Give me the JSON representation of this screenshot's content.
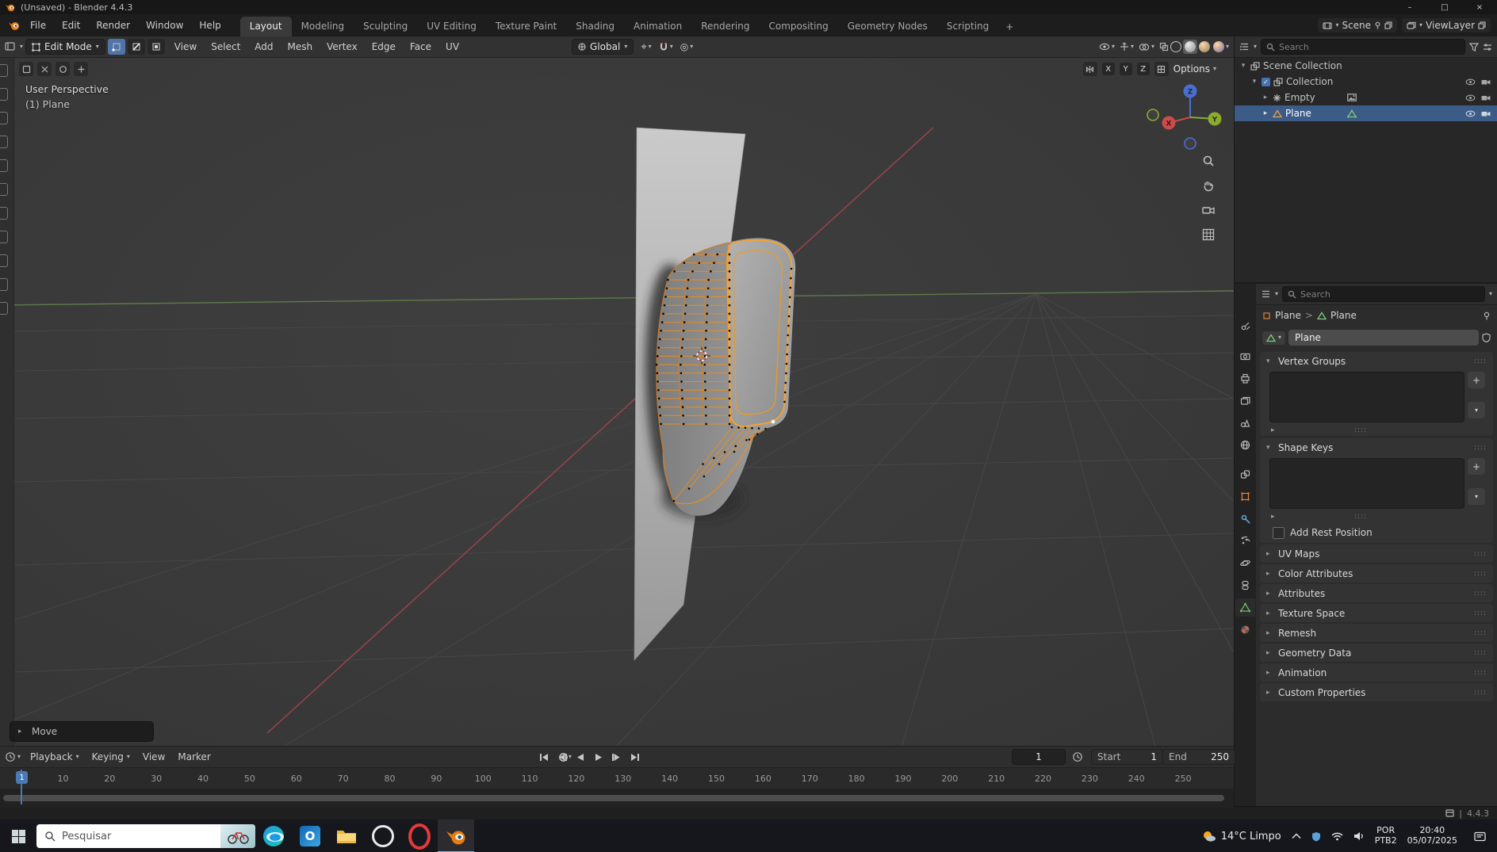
{
  "colors": {
    "accent_orange": "#ff9e2b",
    "selection_blue": "#4772b3",
    "outliner_selection": "#3c5b87",
    "axis_x": "#a4454f",
    "axis_y": "#5e7f4a",
    "gizmo_x": "#cc4b4b",
    "gizmo_y": "#8aab2e",
    "gizmo_z": "#4a6fd0"
  },
  "window": {
    "title": "(Unsaved) - Blender 4.4.3",
    "controls": {
      "minimize": "–",
      "maximize": "□",
      "close": "×"
    }
  },
  "topbar": {
    "menus": [
      "File",
      "Edit",
      "Render",
      "Window",
      "Help"
    ],
    "workspaces": [
      "Layout",
      "Modeling",
      "Sculpting",
      "UV Editing",
      "Texture Paint",
      "Shading",
      "Animation",
      "Rendering",
      "Compositing",
      "Geometry Nodes",
      "Scripting"
    ],
    "active_workspace": "Layout",
    "new_workspace_button": "+",
    "scene_selector": {
      "label": "Scene"
    },
    "viewlayer_selector": {
      "label": "ViewLayer"
    }
  },
  "tool_header": {
    "mode_selector": "Edit Mode",
    "select_mode_icons": [
      "vertex-select",
      "edge-select",
      "face-select"
    ],
    "menus": [
      "View",
      "Select",
      "Add",
      "Mesh",
      "Vertex",
      "Edge",
      "Face",
      "UV"
    ],
    "orientation": "Global",
    "right_icons": [
      "visibility-eye",
      "gizmo",
      "overlays",
      "xray",
      "shading-wireframe",
      "shading-solid",
      "shading-material",
      "shading-rendered"
    ]
  },
  "viewport": {
    "overlay_text": [
      "User Perspective",
      "(1) Plane"
    ],
    "mirror_axis_buttons": [
      "X",
      "Y",
      "Z"
    ],
    "options_button": "Options",
    "gizmo_axes": [
      "X",
      "Y",
      "Z"
    ],
    "side_buttons": [
      "zoom-icon",
      "pan-hand-icon",
      "camera-view-icon",
      "toggle-ortho-icon"
    ],
    "operator_panel": "Move"
  },
  "outliner": {
    "search_placeholder": "Search",
    "rows": [
      {
        "label": "Scene Collection",
        "icon": "collection-icon"
      },
      {
        "label": "Collection",
        "icon": "collection-icon",
        "checked": true
      },
      {
        "label": "Empty",
        "icon": "empty-axes-icon",
        "badge": "image-icon"
      },
      {
        "label": "Plane",
        "icon": "mesh-object-icon",
        "badge": "mesh-data-icon",
        "selected": true
      }
    ],
    "row_icons": [
      "eye-icon",
      "camera-icon"
    ]
  },
  "properties": {
    "search_placeholder": "Search",
    "tabs": [
      "tool",
      "render",
      "output",
      "view-layer",
      "scene",
      "world",
      "collection",
      "object",
      "modifiers",
      "particles",
      "physics",
      "constraints",
      "object-data",
      "material"
    ],
    "active_tab": "object-data",
    "breadcrumb": {
      "object": "Plane",
      "separator": ">",
      "data": "Plane"
    },
    "name_field": "Plane",
    "panels": {
      "vertex_groups": "Vertex Groups",
      "shape_keys": "Shape Keys",
      "add_rest_position": "Add Rest Position",
      "collapsed": [
        "UV Maps",
        "Color Attributes",
        "Attributes",
        "Texture Space",
        "Remesh",
        "Geometry Data",
        "Animation",
        "Custom Properties"
      ]
    }
  },
  "timeline": {
    "menus": [
      "Playback",
      "Keying",
      "View",
      "Marker"
    ],
    "menu_carets": [
      "Playback",
      "Keying"
    ],
    "transport": [
      "jump-to-start",
      "prev-keyframe",
      "play-reverse",
      "play",
      "next-keyframe",
      "jump-to-end"
    ],
    "current_frame": "1",
    "playhead_label": "1",
    "start_label": "Start",
    "start_value": "1",
    "end_label": "End",
    "end_value": "250",
    "ticks": [
      10,
      20,
      30,
      40,
      50,
      60,
      70,
      80,
      90,
      100,
      110,
      120,
      130,
      140,
      150,
      160,
      170,
      180,
      190,
      200,
      210,
      220,
      230,
      240,
      250
    ]
  },
  "status_bar": {
    "separator": "|",
    "version": "4.4.3"
  },
  "taskbar": {
    "search_placeholder": "Pesquisar",
    "apps": [
      "edge",
      "outlook",
      "file-explorer",
      "app-circle",
      "opera",
      "blender"
    ],
    "active_app": "blender",
    "weather": "14°C Limpo",
    "tray_icons": [
      "chevron-up-icon",
      "shield-icon",
      "wifi-icon",
      "volume-icon"
    ],
    "language_line1": "POR",
    "language_line2": "PTB2",
    "time": "20:40",
    "date": "05/07/2025"
  }
}
